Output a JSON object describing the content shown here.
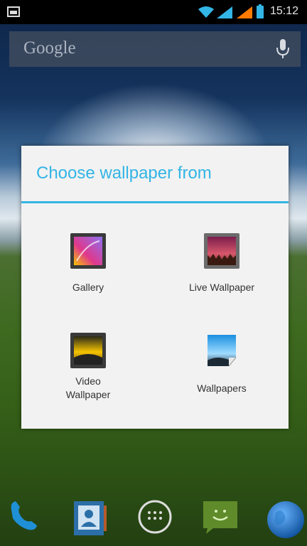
{
  "statusbar": {
    "time": "15:12",
    "icons": [
      "notification-image-icon",
      "wifi-icon",
      "signal-icon",
      "signal-icon",
      "battery-icon"
    ],
    "accent_color": "#33b5e5",
    "signal_color_2": "#ff7a00"
  },
  "search": {
    "brand": "Google",
    "icon": "mic-icon"
  },
  "dialog": {
    "title": "Choose wallpaper from",
    "title_color": "#33b5e5",
    "options": [
      {
        "label": "Gallery",
        "icon": "gallery-icon"
      },
      {
        "label": "Live Wallpaper",
        "icon": "live-wallpaper-icon"
      },
      {
        "label": "Video\nWallpaper",
        "icon": "video-wallpaper-icon"
      },
      {
        "label": "Wallpapers",
        "icon": "wallpapers-icon"
      }
    ]
  },
  "dock": {
    "items": [
      "phone-icon",
      "contacts-icon",
      "app-drawer-icon",
      "messaging-icon",
      "browser-icon"
    ]
  }
}
